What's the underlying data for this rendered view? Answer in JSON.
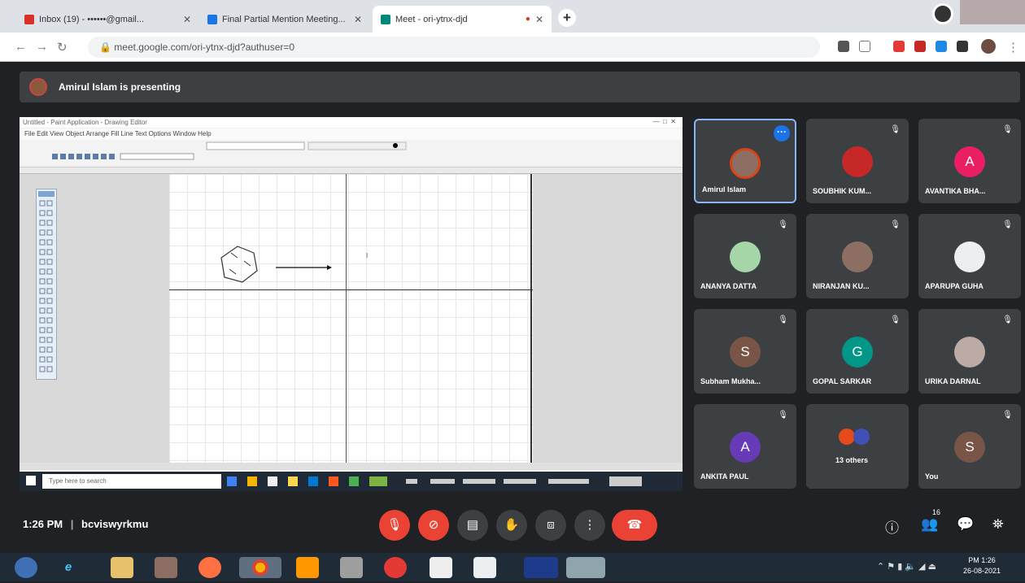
{
  "browser": {
    "tabs": [
      {
        "label": "Inbox (19) - ••••••@gmail...",
        "active": false
      },
      {
        "label": "Final Partial Mention Meeting...",
        "active": false
      },
      {
        "label": "Meet - ori-ytnx-djd",
        "active": true
      }
    ],
    "new_tab_label": "+",
    "url": "meet.google.com/ori-ytnx-djd?authuser=0"
  },
  "meet": {
    "presenting_banner": "Amirul Islam is presenting",
    "participants": [
      {
        "name": "Amirul Islam",
        "avatar": "photo",
        "selected": true
      },
      {
        "name": "SOUBHIK KUM...",
        "avatar": "photo"
      },
      {
        "name": "AVANTIKA BHA...",
        "avatar": "A",
        "color": "#e91e63"
      },
      {
        "name": "ANANYA DATTA",
        "avatar": "photo"
      },
      {
        "name": "NIRANJAN KU...",
        "avatar": "photo"
      },
      {
        "name": "APARUPA GUHA",
        "avatar": "photo"
      },
      {
        "name": "Subham Mukha...",
        "avatar": "S",
        "color": "#795548"
      },
      {
        "name": "GOPAL SARKAR",
        "avatar": "G",
        "color": "#009688"
      },
      {
        "name": "URIKA DARNAL",
        "avatar": "photo"
      },
      {
        "name": "ANKITA PAUL",
        "avatar": "A",
        "color": "#673ab7"
      },
      {
        "name": "13 others",
        "avatar": "group"
      },
      {
        "name": "You",
        "avatar": "S",
        "color": "#795548"
      }
    ],
    "time": "1:26 PM",
    "meeting_code": "bcviswyrkmu",
    "people_count": "16"
  },
  "shared_screen": {
    "app_title": "Untitled - Paint Application - Drawing Editor",
    "menu": "File  Edit  View  Object  Arrange  Fill  Line  Text  Options  Window  Help",
    "search_placeholder": "Type here to search"
  },
  "system": {
    "clock_time": "PM 1:26",
    "clock_date": "26-08-2021"
  },
  "colors": {
    "meet_bg": "#202124",
    "tile_bg": "#3c4043",
    "accent": "#1a73e8",
    "danger": "#ea4335"
  }
}
